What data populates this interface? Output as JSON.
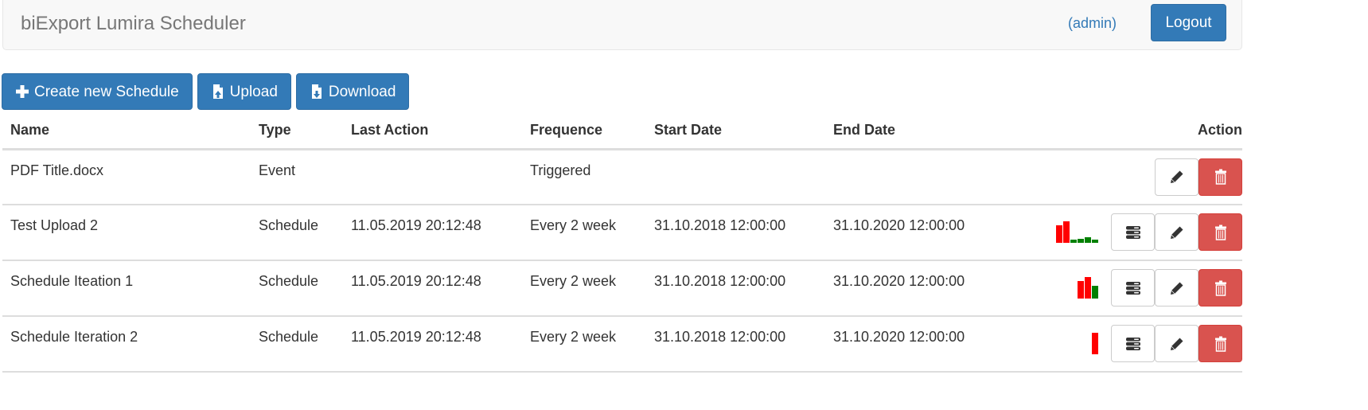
{
  "app": {
    "title": "biExport Lumira Scheduler",
    "user_label": "(admin)",
    "logout_label": "Logout"
  },
  "toolbar": {
    "create_label": "Create new Schedule",
    "upload_label": "Upload",
    "download_label": "Download"
  },
  "colors": {
    "primary": "#337ab7",
    "danger": "#d9534f",
    "spark_fail": "#ff0000",
    "spark_success": "#008000"
  },
  "table": {
    "headers": [
      "Name",
      "Type",
      "Last Action",
      "Frequence",
      "Start Date",
      "End Date",
      "Action"
    ],
    "rows": [
      {
        "name": "PDF Title.docx",
        "type": "Event",
        "last_action": "",
        "frequence": "Triggered",
        "start_date": "",
        "end_date": "",
        "history": [],
        "has_history_button": false
      },
      {
        "name": "Test Upload 2",
        "type": "Schedule",
        "last_action": "11.05.2019 20:12:48",
        "frequence": "Every 2 week",
        "start_date": "31.10.2018 12:00:00",
        "end_date": "31.10.2020 12:00:00",
        "history": [
          {
            "status": "fail",
            "value": 0.8
          },
          {
            "status": "fail",
            "value": 1.0
          },
          {
            "status": "success",
            "value": 0.15
          },
          {
            "status": "success",
            "value": 0.2
          },
          {
            "status": "success",
            "value": 0.25
          },
          {
            "status": "success",
            "value": 0.15
          }
        ],
        "has_history_button": true
      },
      {
        "name": "Schedule Iteation 1",
        "type": "Schedule",
        "last_action": "11.05.2019 20:12:48",
        "frequence": "Every 2 week",
        "start_date": "31.10.2018 12:00:00",
        "end_date": "31.10.2020 12:00:00",
        "history": [
          {
            "status": "fail",
            "value": 0.8
          },
          {
            "status": "fail",
            "value": 1.0
          },
          {
            "status": "success",
            "value": 0.6
          }
        ],
        "has_history_button": true
      },
      {
        "name": "Schedule Iteration 2",
        "type": "Schedule",
        "last_action": "11.05.2019 20:12:48",
        "frequence": "Every 2 week",
        "start_date": "31.10.2018 12:00:00",
        "end_date": "31.10.2020 12:00:00",
        "history": [
          {
            "status": "fail",
            "value": 1.0
          }
        ],
        "has_history_button": true
      }
    ]
  }
}
